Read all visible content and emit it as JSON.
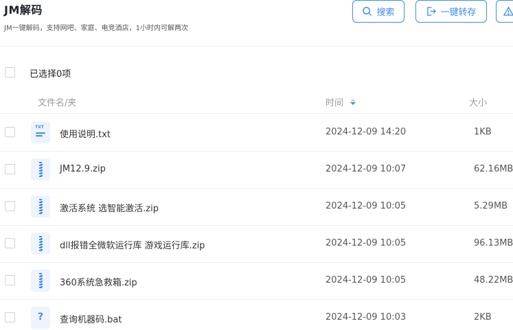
{
  "app": {
    "title": "JM解码",
    "subtitle": "JM一键解码，支持网吧、家庭、电竞酒店，1小时内可解两次"
  },
  "toolbar": {
    "search_label": "搜索",
    "transfer_label": "一键转存"
  },
  "selection": {
    "text": "已选择0项"
  },
  "columns": {
    "name": "文件名/夹",
    "time": "时间",
    "size": "大小"
  },
  "files": [
    {
      "name": "使用说明.txt",
      "time": "2024-12-09 14:20",
      "size": "1KB",
      "icon": "txt-file-icon"
    },
    {
      "name": "JM12.9.zip",
      "time": "2024-12-09 10:07",
      "size": "62.16MB",
      "icon": "zip-file-icon"
    },
    {
      "name": "激活系统 选智能激活.zip",
      "time": "2024-12-09 10:05",
      "size": "5.29MB",
      "icon": "zip-file-icon"
    },
    {
      "name": "dll报错全微软运行库 游戏运行库.zip",
      "time": "2024-12-09 10:05",
      "size": "96.13MB",
      "icon": "zip-file-icon"
    },
    {
      "name": "360系统急救箱.zip",
      "time": "2024-12-09 10:05",
      "size": "48.22MB",
      "icon": "zip-file-icon"
    },
    {
      "name": "查询机器码.bat",
      "time": "2024-12-09 10:03",
      "size": "2KB",
      "icon": "unknown-file-icon"
    }
  ],
  "colors": {
    "accent": "#3d8bf5",
    "border": "#eceff3",
    "muted_text": "#999999"
  }
}
